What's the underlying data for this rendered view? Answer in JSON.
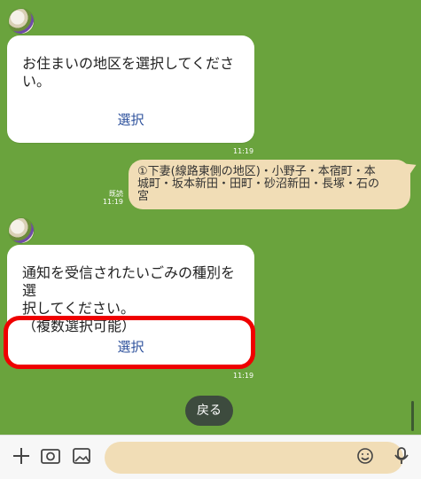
{
  "chat": {
    "message1": "お住まいの地区を選択してください。",
    "message1_button": "選択",
    "message1_time": "11:19",
    "user_reply": "①下妻(線路東側の地区)・小野子・本宿町・本\n城町・坂本新田・田町・砂沼新田・長塚・石の\n宮",
    "user_read_label": "既読",
    "user_time": "11:19",
    "message2": "通知を受信されたいごみの種別を選\n択してください。\n（複数選択可能）",
    "message2_button": "選択",
    "message2_time": "11:19",
    "back_button": "戻る"
  },
  "bottom_bar": {
    "icons": [
      "plus-icon",
      "camera-icon",
      "image-icon",
      "emoji-icon",
      "mic-icon"
    ],
    "input_placeholder": ""
  },
  "colors": {
    "chat_background": "#6aa33d",
    "highlight": "#ef0000",
    "bubble_user": "#f1ddb6"
  }
}
